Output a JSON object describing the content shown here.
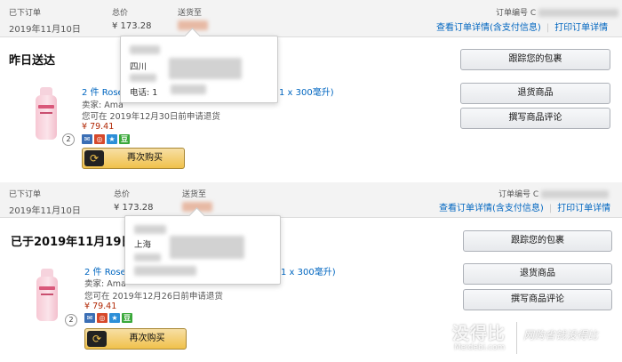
{
  "orders": [
    {
      "header": {
        "placed_label": "已下订单",
        "placed_date": "2019年11月10日",
        "total_label": "总价",
        "total_value": "¥ 173.28",
        "ship_label": "送货至",
        "order_no_label": "订单编号 C",
        "details_link": "查看订单详情(含支付信息)",
        "sep": "|",
        "invoice_link": "打印订单详情"
      },
      "status": "昨日送达",
      "popup": {
        "province": "四川",
        "phone_label": "电话: 1"
      },
      "item": {
        "name": "2 件 Rose",
        "name_tail": "1 x 300毫升)",
        "seller": "卖家: Ama",
        "return_note": "您可在 2019年12月30日前申请退货",
        "price": "¥ 79.41",
        "qty": "2"
      },
      "buttons": {
        "track": "跟踪您的包裹",
        "return": "退货商品",
        "review": "撰写商品评论",
        "rebuy": "再次购买"
      }
    },
    {
      "header": {
        "placed_label": "已下订单",
        "placed_date": "2019年11月10日",
        "total_label": "总价",
        "total_value": "¥ 173.28",
        "ship_label": "送货至",
        "order_no_label": "订单编号 C",
        "details_link": "查看订单详情(含支付信息)",
        "sep": "|",
        "invoice_link": "打印订单详情"
      },
      "status": "已于2019年11月19日",
      "popup": {
        "province": "上海"
      },
      "item": {
        "name": "2 件 Rose",
        "name_tail": "1 x 300毫升)",
        "seller": "卖家: Ama",
        "return_note": "您可在 2019年12月26日前申请退货",
        "price": "¥ 79.41",
        "qty": "2"
      },
      "buttons": {
        "track": "跟踪您的包裹",
        "return": "退货商品",
        "review": "撰写商品评论",
        "rebuy": "再次购买"
      }
    }
  ],
  "watermark": {
    "logo": "没得比",
    "site": "Meidebi.com",
    "slogan": "网购省钱没得比"
  },
  "colors": {
    "link": "#0066c0",
    "price": "#b12704",
    "header_bg": "#f3f3f3",
    "buy_button": "#f0c14b"
  },
  "icons": [
    "email-icon",
    "share-icon",
    "star-icon",
    "bean-icon",
    "repurchase-icon"
  ]
}
